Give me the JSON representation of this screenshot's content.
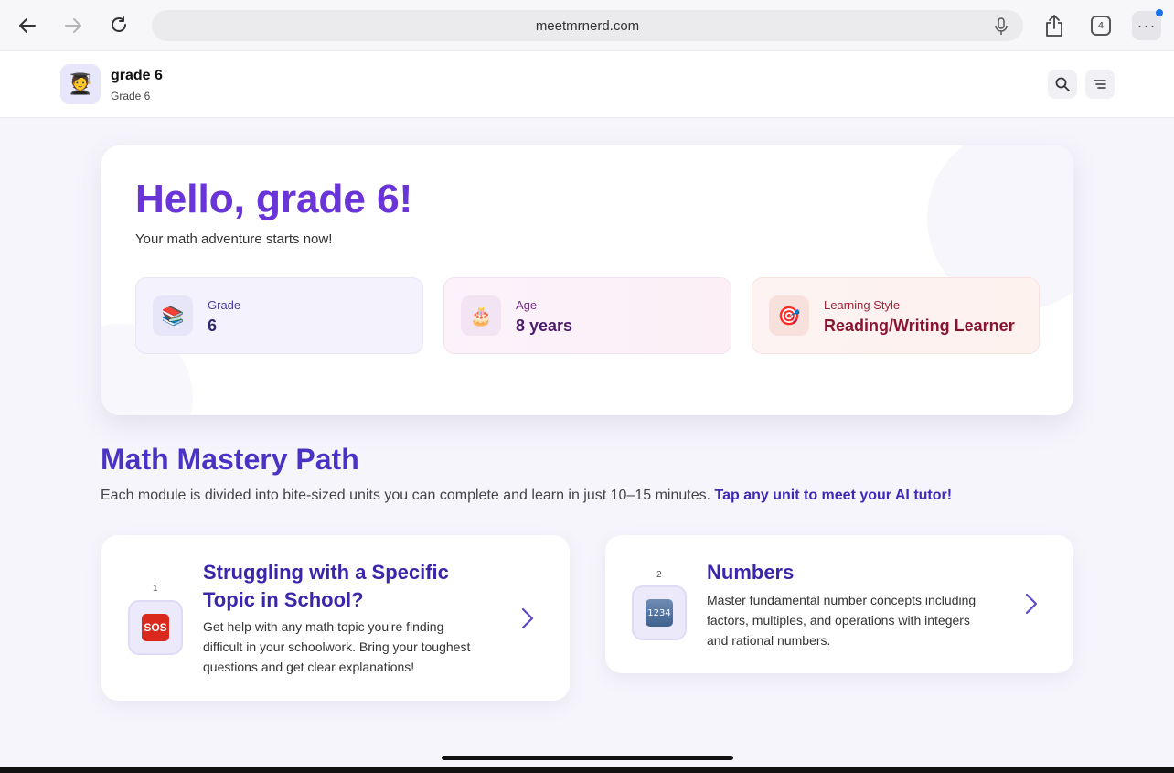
{
  "browser": {
    "url": "meetmrnerd.com",
    "tab_count": "4",
    "back_icon": "arrow-left-icon",
    "forward_icon": "arrow-right-icon",
    "reload_icon": "reload-icon"
  },
  "header": {
    "avatar_icon": "graduate-icon",
    "title": "grade 6",
    "subtitle": "Grade 6"
  },
  "hero": {
    "title": "Hello, grade 6!",
    "subtitle": "Your math adventure starts now!",
    "stats": [
      {
        "label": "Grade",
        "value": "6",
        "icon": "books-icon"
      },
      {
        "label": "Age",
        "value": "8 years",
        "icon": "cake-icon"
      },
      {
        "label": "Learning Style",
        "value": "Reading/Writing Learner",
        "icon": "target-icon"
      }
    ]
  },
  "mastery": {
    "title": "Math Mastery Path",
    "description": "Each module is divided into bite-sized units you can complete and learn in just 10–15 minutes.",
    "cta": "Tap any unit to meet your AI tutor!",
    "modules": [
      {
        "number": "1",
        "icon_text": "SOS",
        "title_line1": "Struggling with a Specific",
        "title_line2": "Topic in School?",
        "desc_line1": "Get help with any math topic you're finding",
        "desc_line2": "difficult in your schoolwork. Bring your toughest",
        "desc_line3": "questions and get clear explanations!"
      },
      {
        "number": "2",
        "icon_text": "1234",
        "title_line1": "Numbers",
        "desc_line1": "Master fundamental number concepts including",
        "desc_line2": "factors, multiples, and operations with integers",
        "desc_line3": "and rational numbers."
      }
    ]
  },
  "colors": {
    "accent": "#6a35d8",
    "heading": "#4a32c4",
    "sos": "#d9281c"
  }
}
